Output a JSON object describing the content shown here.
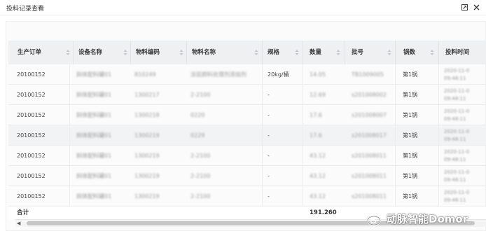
{
  "window": {
    "title": "投料记录查看"
  },
  "table": {
    "columns": [
      "生产订单",
      "设备名称",
      "物料编码",
      "物料名称",
      "规格",
      "数量",
      "批号",
      "锅数",
      "投料时间"
    ],
    "rows": [
      {
        "order": "20100152",
        "device": "斜体配料罐01",
        "code": "810249",
        "name": "涂层颜料处理剂添加剂",
        "spec": "20kg/桶",
        "qty": "14.05",
        "batch": "TB1009005",
        "pot": "第1锅",
        "time1": "2020-11-0",
        "time2": "09:48:11"
      },
      {
        "order": "20100152",
        "device": "斜体配料罐01",
        "code": "1300217",
        "name": "2-2100",
        "spec": "-",
        "qty": "12.69",
        "batch": "s201008002",
        "pot": "第1锅",
        "time1": "2020-11-0",
        "time2": "09:48:11"
      },
      {
        "order": "20100152",
        "device": "斜体配料罐01",
        "code": "1300218",
        "name": "0220",
        "spec": "-",
        "qty": "17.6",
        "batch": "s201008007",
        "pot": "第1锅",
        "time1": "2020-11-0",
        "time2": "09:48:11"
      },
      {
        "order": "20100152",
        "device": "斜体配料罐01",
        "code": "1300219",
        "name": "0229",
        "spec": "-",
        "qty": "17.6",
        "batch": "s201008017",
        "pot": "第1锅",
        "time1": "2020-11-0",
        "time2": "09:48:11"
      },
      {
        "order": "20100152",
        "device": "斜体配料罐01",
        "code": "1300219",
        "name": "2-2100",
        "spec": "-",
        "qty": "43.12",
        "batch": "s201008011",
        "pot": "第1锅",
        "time1": "2020-11-0",
        "time2": "09:48:11"
      },
      {
        "order": "20100152",
        "device": "斜体配料罐01",
        "code": "1300219",
        "name": "2-2100",
        "spec": "-",
        "qty": "43.12",
        "batch": "s201008011",
        "pot": "第1锅",
        "time1": "2020-11-0",
        "time2": "09:48:11"
      },
      {
        "order": "20100152",
        "device": "斜体配料罐01",
        "code": "1300219",
        "name": "2-2100",
        "spec": "-",
        "qty": "43.12",
        "batch": "s201008011",
        "pot": "第1锅",
        "time1": "2020-11-0",
        "time2": "09:48:11"
      }
    ],
    "total": {
      "label": "合计",
      "qty": "191.260"
    }
  },
  "watermark": {
    "text": "动脉智能Domor"
  },
  "icons": {
    "maximize": "maximize-icon",
    "close": "close-icon",
    "sort": "sort-icon",
    "scroll_left": "arrow-left-icon",
    "watermark": "weibo-icon"
  },
  "colors": {
    "header_bg": "#eef0f2",
    "row_alt": "#f2f3f5",
    "scroll_thumb": "#c6c6c6"
  }
}
